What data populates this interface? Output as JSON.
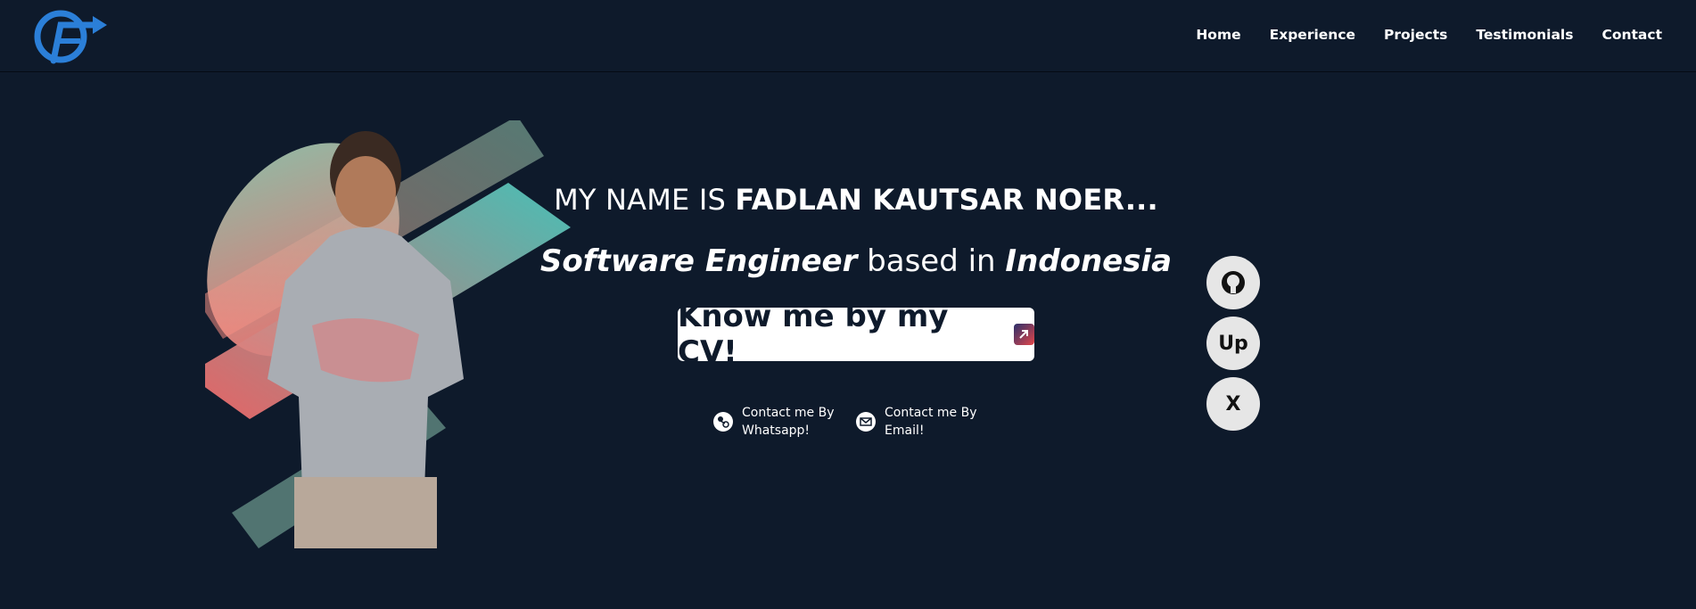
{
  "nav": {
    "items": [
      "Home",
      "Experience",
      "Projects",
      "Testimonials",
      "Contact"
    ]
  },
  "hero": {
    "title_prefix": "MY NAME IS ",
    "title_name": "FADLAN KAUTSAR NOER...",
    "subtitle_role": "Software Engineer",
    "subtitle_mid": " based in ",
    "subtitle_place": "Indonesia",
    "cv_label": "Know me by my CV!",
    "contact_whatsapp_line1": "Contact me By",
    "contact_whatsapp_line2": "Whatsapp!",
    "contact_email_line1": "Contact me By",
    "contact_email_line2": "Email!"
  },
  "social": {
    "upwork_label": "Up",
    "x_label": "X"
  },
  "icons": {
    "logo": "brand-logo-icon",
    "cv": "external-link-icon",
    "whatsapp": "whatsapp-icon",
    "email": "email-icon",
    "github": "github-icon",
    "upwork": "upwork-icon",
    "x": "x-icon"
  },
  "colors": {
    "background": "#0e1a2b",
    "accent_blue": "#2b7fd8",
    "accent_red": "#ff6b6b",
    "accent_teal": "#4fd1c5"
  }
}
